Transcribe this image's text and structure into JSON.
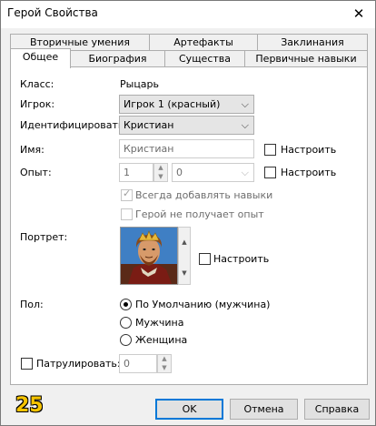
{
  "window": {
    "title": "Герой Свойства",
    "close_glyph": "✕"
  },
  "tabs_row1": [
    {
      "label": "Вторичные умения"
    },
    {
      "label": "Артефакты"
    },
    {
      "label": "Заклинания"
    }
  ],
  "tabs_row2": [
    {
      "label": "Общее",
      "active": true
    },
    {
      "label": "Биография"
    },
    {
      "label": "Существа"
    },
    {
      "label": "Первичные навыки"
    }
  ],
  "general": {
    "class_label": "Класс:",
    "class_value": "Рыцарь",
    "player_label": "Игрок:",
    "player_value": "Игрок 1 (красный)",
    "identify_label": "Идентифицировать",
    "identify_value": "Кристиан",
    "name_label": "Имя:",
    "name_value": "Кристиан",
    "name_custom_label": "Настроить",
    "exp_label": "Опыт:",
    "exp_value": "1",
    "exp_select_value": "0",
    "exp_custom_label": "Настроить",
    "always_add_skills_label": "Всегда добавлять навыки",
    "no_exp_label": "Герой не получает опыт",
    "portrait_label": "Портрет:",
    "portrait_custom_label": "Настроить",
    "gender_label": "Пол:",
    "gender_options": [
      "По Умолчанию (мужчина)",
      "Мужчина",
      "Женщина"
    ],
    "patrol_label": "Патрулировать:",
    "patrol_value": "0"
  },
  "footer": {
    "badge": "25",
    "ok": "OK",
    "cancel": "Отмена",
    "help": "Справка"
  }
}
